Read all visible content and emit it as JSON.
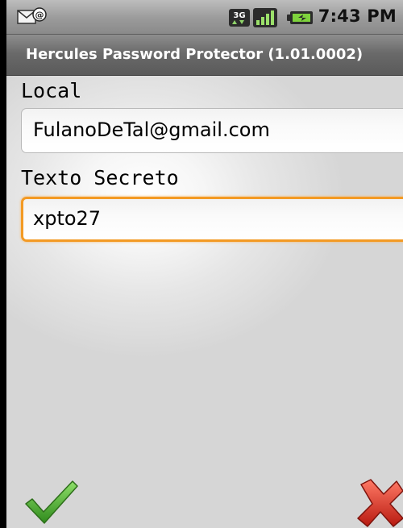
{
  "status_bar": {
    "time": "7:43 PM",
    "network_type": "3G",
    "icons": [
      "mail-notification-icon",
      "network-3g-icon",
      "signal-strength-icon",
      "battery-icon"
    ]
  },
  "title_bar": {
    "title": "Hercules Password Protector (1.01.0002)"
  },
  "form": {
    "local_label": "Local",
    "local_value": "FulanoDeTal@gmail.com",
    "secret_label": "Texto Secreto",
    "secret_value": "xpto27"
  },
  "actions": {
    "confirm_icon": "checkmark-icon",
    "cancel_icon": "close-x-icon"
  },
  "colors": {
    "focus_border": "#f39a24",
    "confirm_green": "#4aa52a",
    "cancel_red": "#d42a1e"
  }
}
